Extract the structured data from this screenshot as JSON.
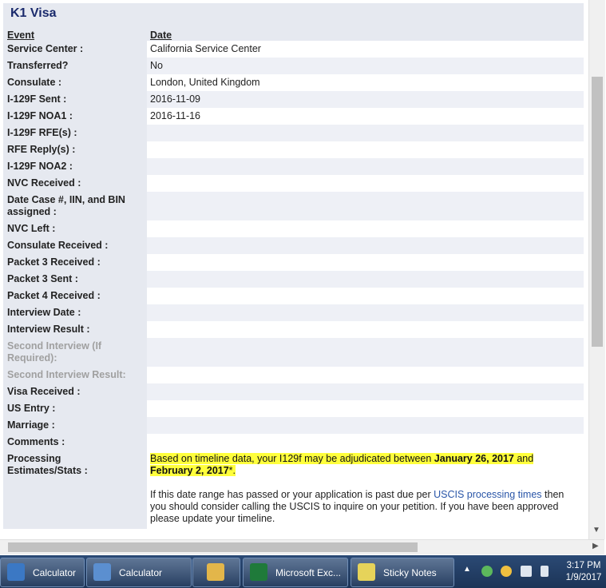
{
  "section_title": "K1 Visa",
  "headers": {
    "event": "Event",
    "date": "Date"
  },
  "rows": [
    {
      "label": "Service Center :",
      "value": "California Service Center"
    },
    {
      "label": "Transferred?",
      "value": "No"
    },
    {
      "label": "Consulate :",
      "value": "London, United Kingdom"
    },
    {
      "label": "I-129F Sent :",
      "value": "2016-11-09"
    },
    {
      "label": "I-129F NOA1 :",
      "value": "2016-11-16"
    },
    {
      "label": "I-129F RFE(s) :",
      "value": ""
    },
    {
      "label": "RFE Reply(s) :",
      "value": ""
    },
    {
      "label": "I-129F NOA2 :",
      "value": ""
    },
    {
      "label": "NVC Received :",
      "value": ""
    },
    {
      "label": "Date Case #, IIN, and BIN assigned :",
      "value": ""
    },
    {
      "label": "NVC Left :",
      "value": ""
    },
    {
      "label": "Consulate Received :",
      "value": ""
    },
    {
      "label": "Packet 3 Received :",
      "value": ""
    },
    {
      "label": "Packet 3 Sent :",
      "value": ""
    },
    {
      "label": "Packet 4 Received :",
      "value": ""
    },
    {
      "label": "Interview Date :",
      "value": ""
    },
    {
      "label": "Interview Result :",
      "value": ""
    },
    {
      "label": "Second Interview (If Required):",
      "value": ""
    },
    {
      "label": "Second Interview Result:",
      "value": ""
    },
    {
      "label": "Visa Received :",
      "value": ""
    },
    {
      "label": "US Entry :",
      "value": ""
    },
    {
      "label": "Marriage :",
      "value": ""
    },
    {
      "label": "Comments :",
      "value": ""
    },
    {
      "label": "Processing Estimates/Stats :",
      "value": ""
    }
  ],
  "estimate": {
    "prefix": "Based on timeline data, your I129f may be adjudicated between ",
    "date1": "January 26, 2017",
    "and": " and ",
    "date2": "February 2, 2017",
    "suffix": "*."
  },
  "note": {
    "before_link": "If this date range has passed or your application is past due per ",
    "link": "USCIS processing times",
    "after_link": " then you should consider calling the USCIS to inquire on your petition. If you have been approved please update your timeline."
  },
  "taskbar": {
    "items": [
      {
        "label": "Calculator",
        "icon": "calculator-icon",
        "color": "#3b78c4"
      },
      {
        "label": "Calculator",
        "icon": "calculator-icon",
        "color": "#5b8fd0"
      },
      {
        "label": "",
        "icon": "folder-icon",
        "color": "#e3b64a"
      },
      {
        "label": "Microsoft Exc...",
        "icon": "excel-icon",
        "color": "#1f7a3a"
      },
      {
        "label": "Sticky Notes",
        "icon": "sticky-notes-icon",
        "color": "#e6d35a"
      }
    ],
    "clock_time": "3:17 PM",
    "clock_date": "1/9/2017"
  }
}
